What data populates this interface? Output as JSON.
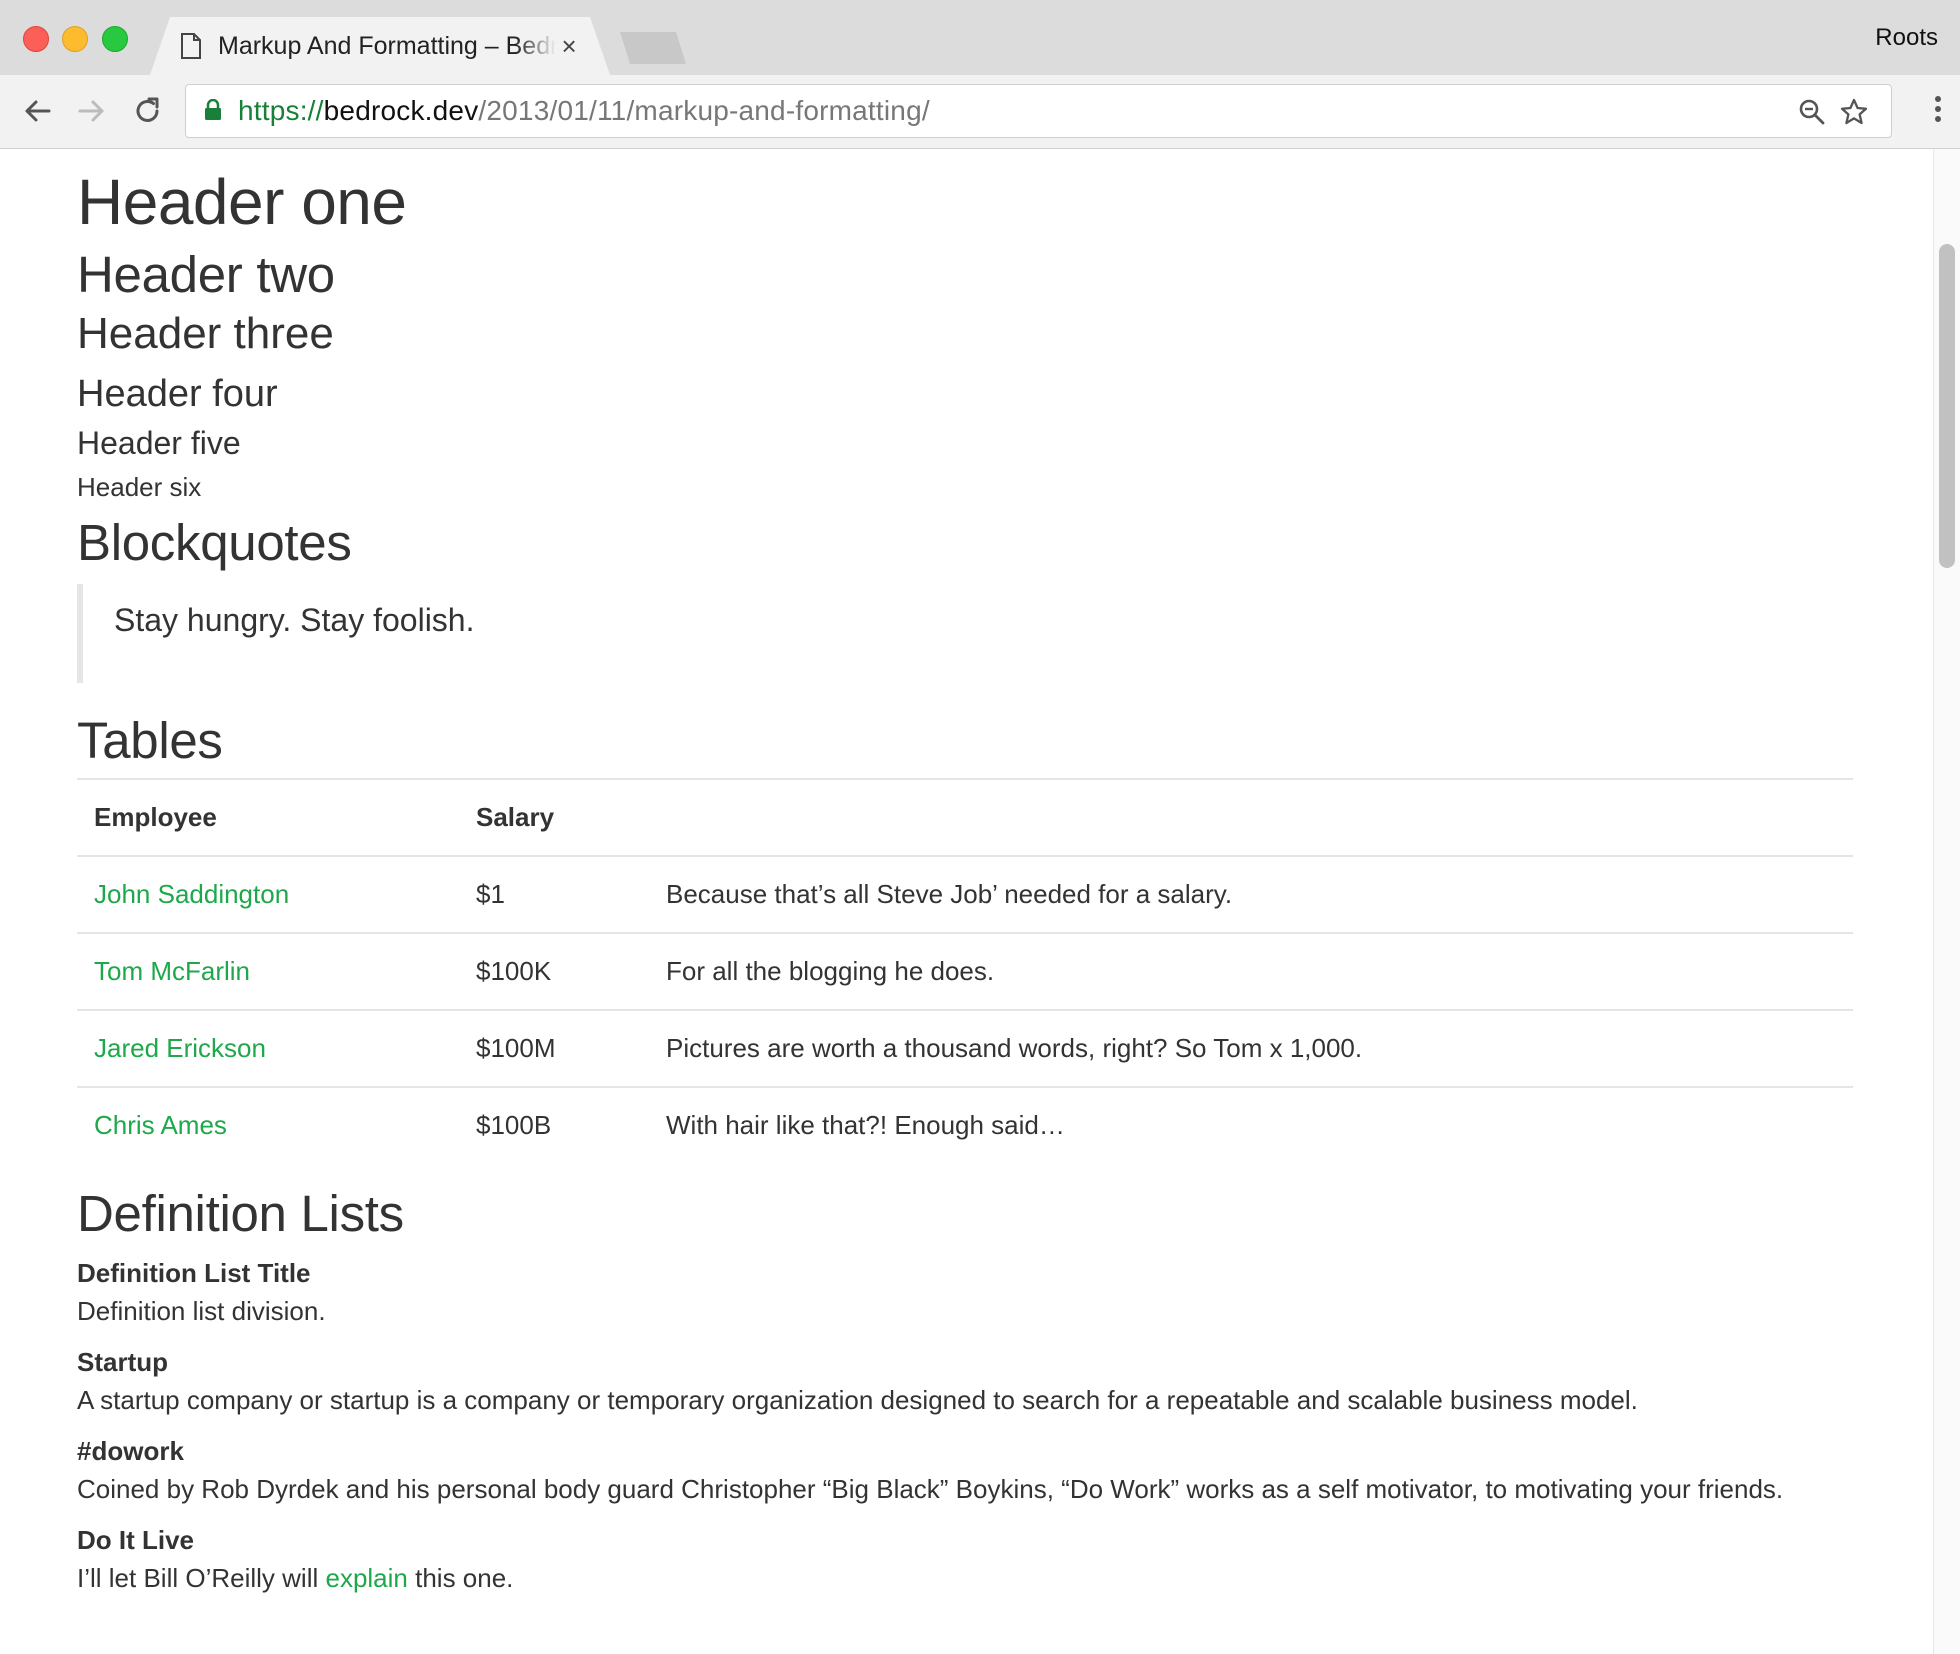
{
  "browser": {
    "tab": {
      "title": "Markup And Formatting – Bedrock",
      "close_glyph": "×"
    },
    "profile_label": "Roots",
    "url": {
      "scheme": "https://",
      "host": "bedrock.dev",
      "path": "/2013/01/11/markup-and-formatting/"
    },
    "icons": [
      "back-arrow-icon",
      "forward-arrow-icon",
      "reload-icon",
      "lock-icon",
      "zoom-icon",
      "star-icon",
      "kebab-menu-icon",
      "document-icon"
    ]
  },
  "article": {
    "headers": {
      "h1": "Header one",
      "h2": "Header two",
      "h3": "Header three",
      "h4": "Header four",
      "h5": "Header five",
      "h6": "Header six"
    },
    "blockquotes": {
      "heading": "Blockquotes",
      "quote": "Stay hungry. Stay foolish."
    },
    "tables": {
      "heading": "Tables",
      "columns": [
        "Employee",
        "Salary",
        ""
      ],
      "rows": [
        {
          "employee": "John Saddington",
          "salary": "$1",
          "note": "Because that’s all Steve Job’ needed for a salary."
        },
        {
          "employee": "Tom McFarlin",
          "salary": "$100K",
          "note": "For all the blogging he does."
        },
        {
          "employee": "Jared Erickson",
          "salary": "$100M",
          "note": "Pictures are worth a thousand words, right? So Tom x 1,000."
        },
        {
          "employee": "Chris Ames",
          "salary": "$100B",
          "note": "With hair like that?! Enough said…"
        }
      ]
    },
    "definition_lists": {
      "heading": "Definition Lists",
      "items": [
        {
          "term": "Definition List Title",
          "desc": "Definition list division."
        },
        {
          "term": "Startup",
          "desc": "A startup company or startup is a company or temporary organization designed to search for a repeatable and scalable business model."
        },
        {
          "term": "#dowork",
          "desc": "Coined by Rob Dyrdek and his personal body guard Christopher “Big Black” Boykins, “Do Work” works as a self motivator, to motivating your friends."
        },
        {
          "term": "Do It Live",
          "desc_before": "I’ll let Bill O’Reilly will ",
          "desc_link": "explain",
          "desc_after": " this one."
        }
      ]
    }
  },
  "colors": {
    "link": "#1ea84b",
    "secure": "#188038",
    "text": "#333333"
  }
}
